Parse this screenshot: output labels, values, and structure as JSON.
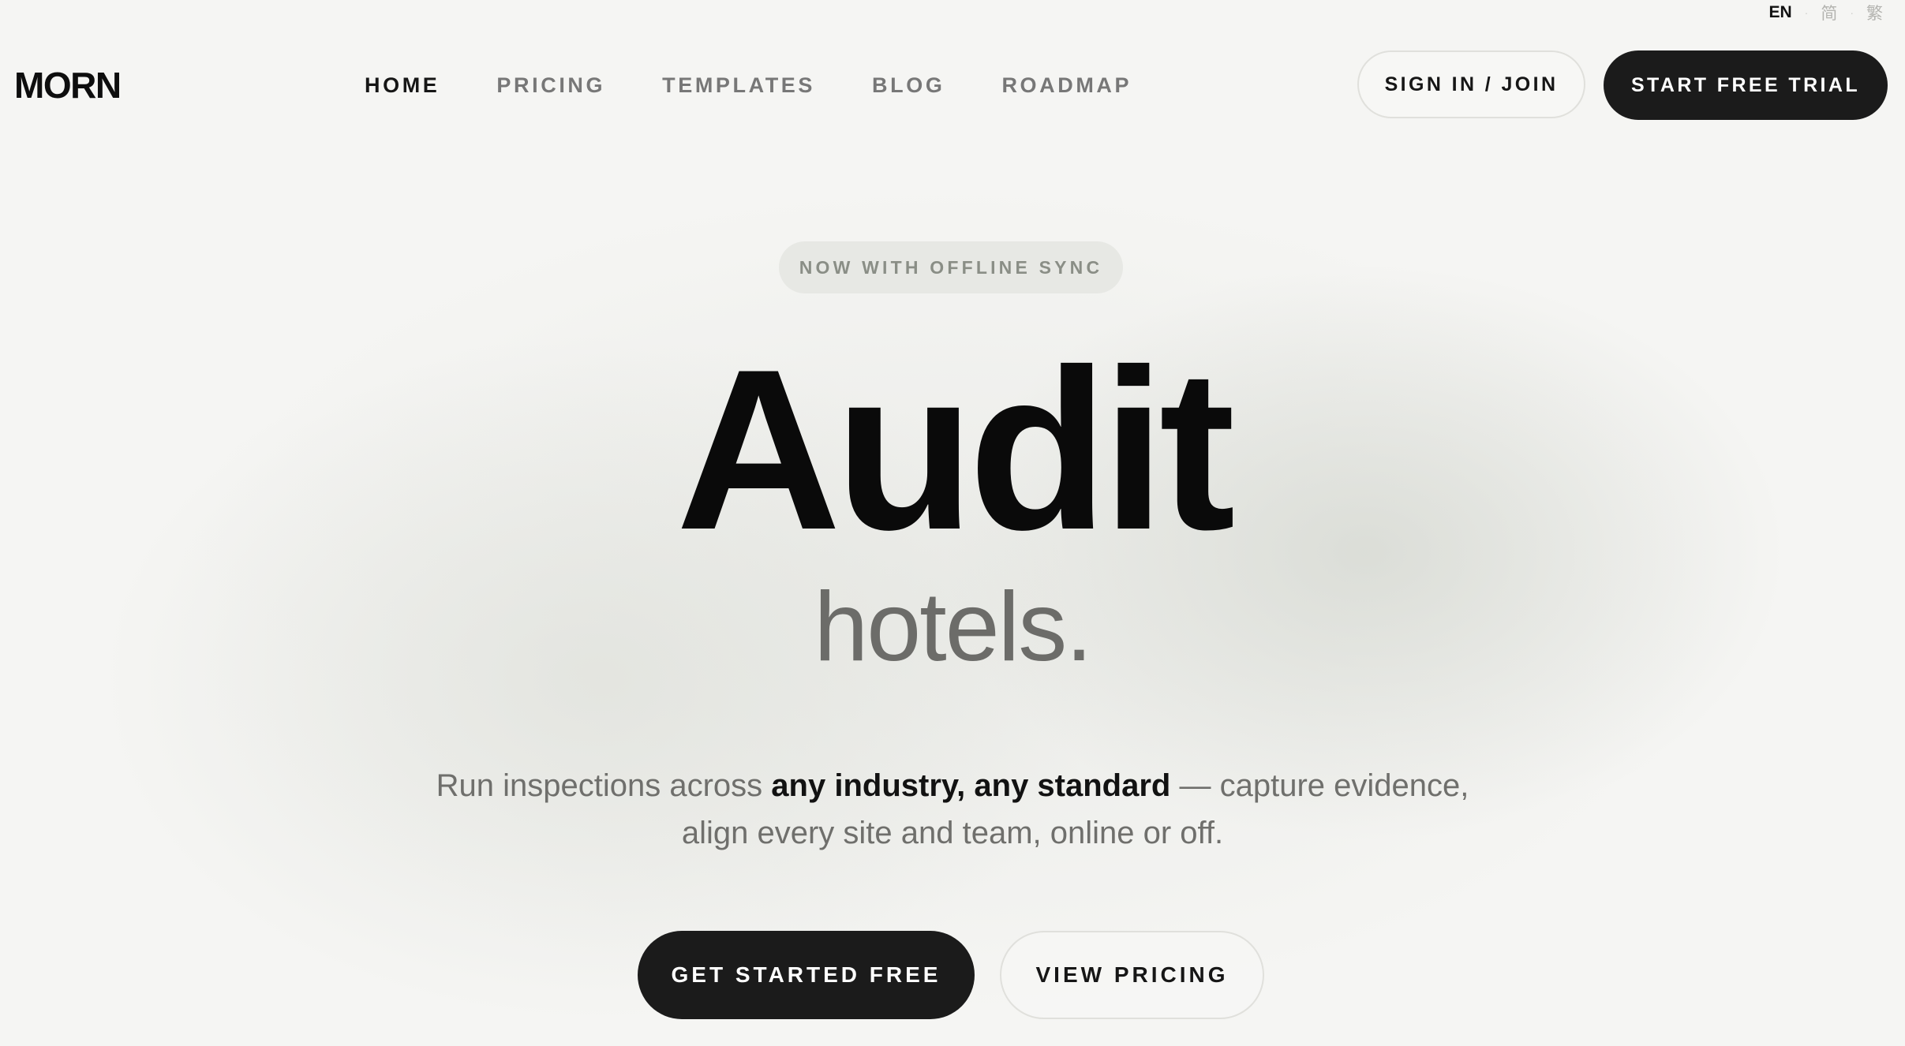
{
  "language_switcher": {
    "active": "EN",
    "options": [
      "简",
      "繁"
    ],
    "separator": "·"
  },
  "header": {
    "logo": "MORN",
    "nav": [
      {
        "label": "HOME",
        "active": true
      },
      {
        "label": "PRICING",
        "active": false
      },
      {
        "label": "TEMPLATES",
        "active": false
      },
      {
        "label": "BLOG",
        "active": false
      },
      {
        "label": "ROADMAP",
        "active": false
      }
    ],
    "sign_in_label": "SIGN IN / JOIN",
    "trial_label": "START FREE TRIAL"
  },
  "hero": {
    "badge": "NOW WITH OFFLINE SYNC",
    "title": "Audit",
    "subtitle": "hotels.",
    "description": {
      "part1": "Run inspections across ",
      "emphasis": "any industry, any standard",
      "part2": " — capture evidence,",
      "line2": "align every site and team, online or off."
    },
    "primary_cta": "GET STARTED FREE",
    "secondary_cta": "VIEW PRICING"
  },
  "colors": {
    "background": "#f5f5f3",
    "dark_button": "#1b1b1b",
    "badge_bg": "#e7e8e4",
    "muted_text": "#6f6f6c"
  }
}
